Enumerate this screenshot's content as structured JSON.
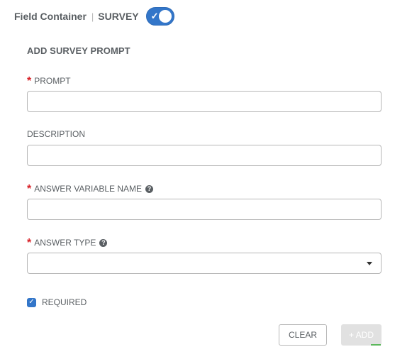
{
  "header": {
    "title": "Field Container",
    "separator": "|",
    "section": "SURVEY",
    "toggle_on": true,
    "toggle_icon": "check-icon"
  },
  "form": {
    "title": "ADD SURVEY PROMPT",
    "prompt": {
      "label": "PROMPT",
      "required": "*",
      "value": "",
      "placeholder": ""
    },
    "description": {
      "label": "DESCRIPTION",
      "value": "",
      "placeholder": ""
    },
    "variable": {
      "label": "ANSWER VARIABLE NAME",
      "required": "*",
      "help": "?",
      "value": "",
      "placeholder": ""
    },
    "answer_type": {
      "label": "ANSWER TYPE",
      "required": "*",
      "help": "?",
      "selected": ""
    },
    "required_checkbox": {
      "label": "REQUIRED",
      "checked": true,
      "check": "✓"
    },
    "buttons": {
      "clear": "CLEAR",
      "add": "+ ADD"
    }
  },
  "colors": {
    "accent": "#3376c9",
    "required": "#d81f26",
    "disabled": "#e1e1e1",
    "success": "#5cb85c"
  }
}
